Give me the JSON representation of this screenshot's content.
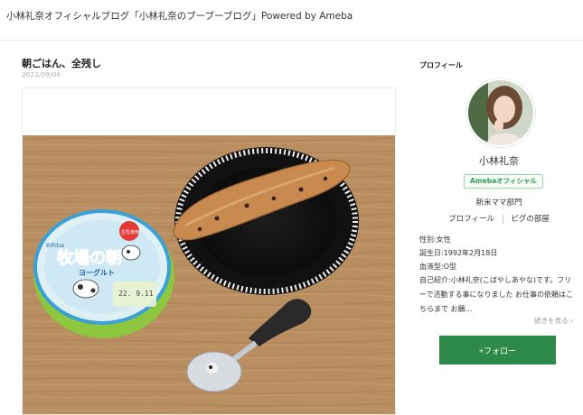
{
  "header": {
    "blog_title": "小林礼奈オフィシャルブログ「小林礼奈のブーブーブログ」Powered by Ameba"
  },
  "post": {
    "title": "朝ごはん、全残し",
    "date": "2022/09/06"
  },
  "photo": {
    "yogurt_brand_small": "Bifidus",
    "yogurt_name": "牧場の朝",
    "yogurt_sub": "ヨーグルト",
    "yogurt_badge": "生乳使用",
    "yogurt_date": "22. 9.11"
  },
  "sidebar": {
    "heading": "プロフィール",
    "name": "小林礼奈",
    "official_badge": "Amebaオフィシャル",
    "ranking": "新米ママ部門",
    "links": [
      "プロフィール",
      "ピグの部屋"
    ],
    "gender": "性別:女性",
    "birthday": "誕生日:1992年2月18日",
    "blood": "血液型:O型",
    "bio": "自己紹介:小林礼奈(こばやしあやな)です。フリーで活動する事になりました お仕事の依頼はこちらまで お願…",
    "more_label": "続きを見る",
    "follow_label": "+フォロー"
  },
  "colors": {
    "accent": "#2d8a4a",
    "badge_text": "#2d9a52"
  }
}
